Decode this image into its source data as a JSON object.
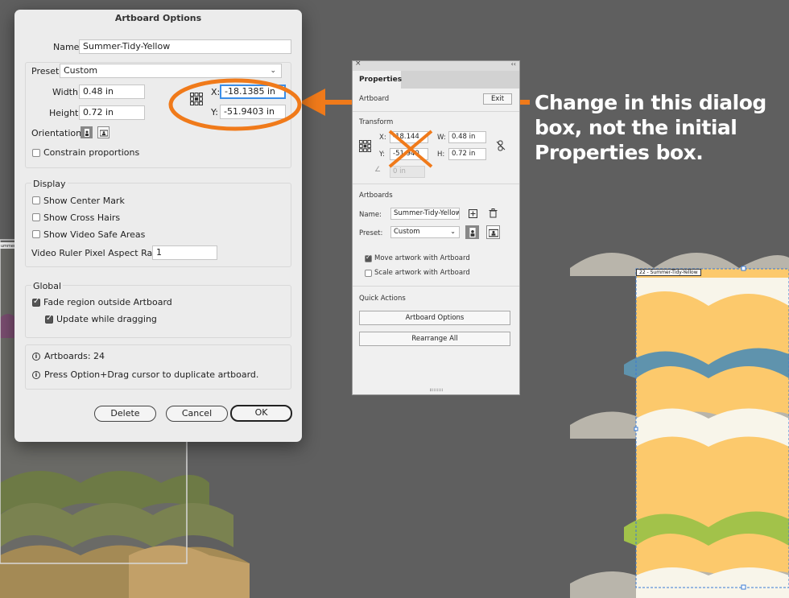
{
  "dialog": {
    "title": "Artboard Options",
    "name_label": "Name:",
    "name_value": "Summer-Tidy-Yellow",
    "preset_label": "Preset:",
    "preset_value": "Custom",
    "width_label": "Width:",
    "width_value": "0.48 in",
    "height_label": "Height:",
    "height_value": "0.72 in",
    "x_label": "X:",
    "x_value": "-18.1385 in",
    "y_label": "Y:",
    "y_value": "-51.9403 in",
    "orientation_label": "Orientation:",
    "constrain_label": "Constrain proportions",
    "display_heading": "Display",
    "show_center_mark": "Show Center Mark",
    "show_cross_hairs": "Show Cross Hairs",
    "show_video_safe": "Show Video Safe Areas",
    "ruler_ratio_label": "Video Ruler Pixel Aspect Ratio:",
    "ruler_ratio_value": "1",
    "global_heading": "Global",
    "fade_region": "Fade region outside Artboard",
    "update_dragging": "Update while dragging",
    "artboards_count": "Artboards: 24",
    "hint": "Press Option+Drag cursor to duplicate artboard.",
    "delete_label": "Delete",
    "cancel_label": "Cancel",
    "ok_label": "OK"
  },
  "panel": {
    "tab_label": "Properties",
    "artboard_row_label": "Artboard",
    "exit_label": "Exit",
    "transform_heading": "Transform",
    "x_label": "X:",
    "x_value": "-18.144",
    "y_label": "Y:",
    "y_value": "-51.940",
    "w_label": "W:",
    "w_value": "0.48 in",
    "h_label": "H:",
    "h_value": "0.72 in",
    "angle_value": "0 in",
    "artboards_heading": "Artboards",
    "name_label": "Name:",
    "name_value": "Summer-Tidy-Yellow",
    "preset_label": "Preset:",
    "preset_value": "Custom",
    "move_artwork": "Move artwork with Artboard",
    "scale_artwork": "Scale artwork with Artboard",
    "quick_actions_heading": "Quick Actions",
    "artboard_options_btn": "Artboard Options",
    "rearrange_btn": "Rearrange All"
  },
  "annotation": {
    "text": "Change in this dialog box, not the initial Properties box."
  },
  "artboard_tag": "22 - Summer-Tidy-Yellow",
  "left_artboard_tag": "ummer-Tidy",
  "colors": {
    "accent_orange": "#f07a1a",
    "canvas_bg": "#5f5f5f",
    "scale_yellow": "#fcc96c",
    "scale_blue": "#5f93ad",
    "scale_green": "#a2c24a",
    "scale_cream": "#f8f5ea",
    "scale_gray": "#b9b5ab"
  }
}
